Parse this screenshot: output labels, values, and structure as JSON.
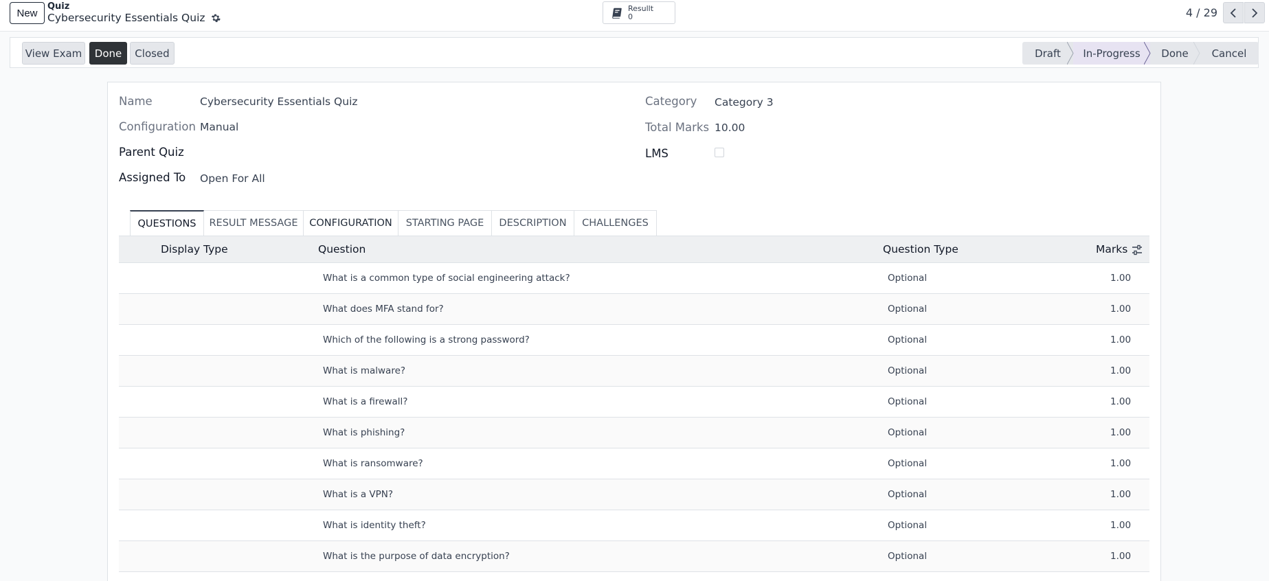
{
  "control_panel": {
    "new_label": "New",
    "breadcrumb_parent": "Quiz",
    "breadcrumb_current": "Cybersecurity Essentials Quiz",
    "smart_button": {
      "label": "Resullt",
      "count": "0"
    },
    "pager": "4 / 29"
  },
  "statusbar": {
    "buttons": {
      "view_exam": "View Exam",
      "done": "Done",
      "closed": "Closed"
    },
    "stages": [
      "Draft",
      "In-Progress",
      "Done",
      "Cancel"
    ],
    "active_stage": "In-Progress"
  },
  "form": {
    "fields": {
      "name": {
        "label": "Name",
        "value": "Cybersecurity Essentials Quiz"
      },
      "configuration": {
        "label": "Configuration",
        "value": "Manual"
      },
      "parent_quiz": {
        "label": "Parent Quiz",
        "value": ""
      },
      "assigned_to": {
        "label": "Assigned To",
        "value": "Open For All"
      },
      "category": {
        "label": "Category",
        "value": "Category 3"
      },
      "total_marks": {
        "label": "Total Marks",
        "value": "10.00"
      },
      "lms": {
        "label": "LMS",
        "checked": false
      }
    },
    "tabs": [
      "QUESTIONS",
      "RESULT MESSAGE",
      "CONFIGURATION",
      "STARTING PAGE",
      "DESCRIPTION",
      "CHALLENGES"
    ],
    "active_tab": "QUESTIONS"
  },
  "questions_table": {
    "columns": {
      "display_type": "Display Type",
      "question": "Question",
      "question_type": "Question Type",
      "marks": "Marks"
    },
    "rows": [
      {
        "question": "What is a common type of social engineering attack?",
        "type": "Optional",
        "marks": "1.00"
      },
      {
        "question": "What does MFA stand for?",
        "type": "Optional",
        "marks": "1.00"
      },
      {
        "question": "Which of the following is a strong password?",
        "type": "Optional",
        "marks": "1.00"
      },
      {
        "question": "What is malware?",
        "type": "Optional",
        "marks": "1.00"
      },
      {
        "question": "What is a firewall?",
        "type": "Optional",
        "marks": "1.00"
      },
      {
        "question": "What is phishing?",
        "type": "Optional",
        "marks": "1.00"
      },
      {
        "question": "What is ransomware?",
        "type": "Optional",
        "marks": "1.00"
      },
      {
        "question": "What is a VPN?",
        "type": "Optional",
        "marks": "1.00"
      },
      {
        "question": "What is identity theft?",
        "type": "Optional",
        "marks": "1.00"
      },
      {
        "question": "What is the purpose of data encryption?",
        "type": "Optional",
        "marks": "1.00"
      }
    ]
  },
  "colors": {
    "primary_dark": "#2f3337",
    "stage_active": "#e7e3f2",
    "background": "#f9fafb"
  },
  "icons": {
    "settings": "gear-icon",
    "smart_button": "book-icon",
    "pager_prev": "chevron-left-icon",
    "pager_next": "chevron-right-icon",
    "columns": "sliders-icon"
  }
}
